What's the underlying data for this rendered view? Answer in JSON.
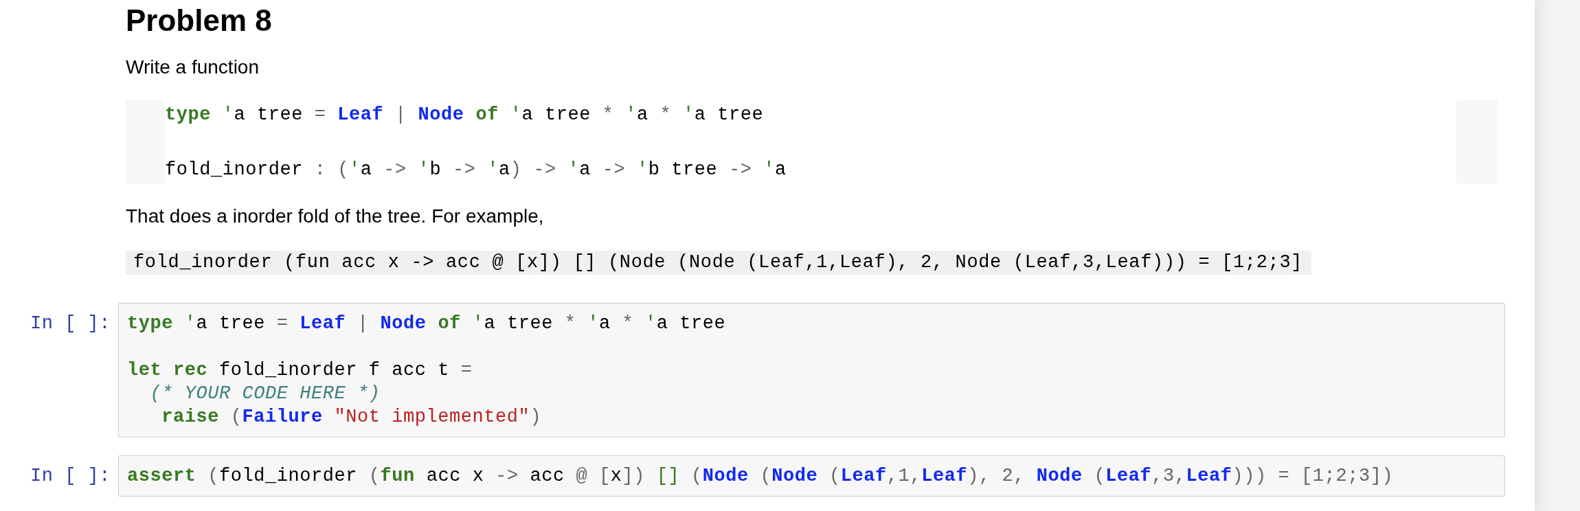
{
  "heading": "Problem 8",
  "intro": "Write a function",
  "signature_block": {
    "blocks": [
      [
        {
          "tokens": [
            {
              "kind": "keyword",
              "text": "type "
            },
            {
              "kind": "quote",
              "text": "'"
            },
            {
              "kind": "plain",
              "text": "a tree "
            },
            {
              "kind": "operator",
              "text": "= "
            },
            {
              "kind": "constructor",
              "text": "Leaf "
            },
            {
              "kind": "operator",
              "text": "| "
            },
            {
              "kind": "constructor",
              "text": "Node "
            },
            {
              "kind": "keyword",
              "text": "of "
            },
            {
              "kind": "quote",
              "text": "'"
            },
            {
              "kind": "plain",
              "text": "a tree "
            },
            {
              "kind": "operator",
              "text": "* "
            },
            {
              "kind": "quote",
              "text": "'"
            },
            {
              "kind": "plain",
              "text": "a "
            },
            {
              "kind": "operator",
              "text": "* "
            },
            {
              "kind": "quote",
              "text": "'"
            },
            {
              "kind": "plain",
              "text": "a tree"
            }
          ]
        }
      ],
      [
        {
          "tokens": [
            {
              "kind": "plain",
              "text": "fold_inorder "
            },
            {
              "kind": "operator",
              "text": ": ("
            },
            {
              "kind": "quote",
              "text": "'"
            },
            {
              "kind": "plain",
              "text": "a "
            },
            {
              "kind": "operator",
              "text": "-> "
            },
            {
              "kind": "quote",
              "text": "'"
            },
            {
              "kind": "plain",
              "text": "b "
            },
            {
              "kind": "operator",
              "text": "-> "
            },
            {
              "kind": "quote",
              "text": "'"
            },
            {
              "kind": "plain",
              "text": "a"
            },
            {
              "kind": "operator",
              "text": ") -> "
            },
            {
              "kind": "quote",
              "text": "'"
            },
            {
              "kind": "plain",
              "text": "a "
            },
            {
              "kind": "operator",
              "text": "-> "
            },
            {
              "kind": "quote",
              "text": "'"
            },
            {
              "kind": "plain",
              "text": "b tree "
            },
            {
              "kind": "operator",
              "text": "-> "
            },
            {
              "kind": "quote",
              "text": "'"
            },
            {
              "kind": "plain",
              "text": "a"
            }
          ]
        }
      ]
    ]
  },
  "description": "That does a inorder fold of the tree. For example,",
  "example": "fold_inorder (fun acc x -> acc @ [x]) [] (Node (Node (Leaf,1,Leaf), 2, Node (Leaf,3,Leaf))) = [1;2;3]",
  "cells": [
    {
      "prompt": "In [ ]:",
      "blocks": [
        [
          {
            "tokens": [
              {
                "kind": "keyword",
                "text": "type "
              },
              {
                "kind": "quote",
                "text": "'"
              },
              {
                "kind": "plain",
                "text": "a tree "
              },
              {
                "kind": "operator",
                "text": "= "
              },
              {
                "kind": "constructor",
                "text": "Leaf "
              },
              {
                "kind": "operator",
                "text": "| "
              },
              {
                "kind": "constructor",
                "text": "Node "
              },
              {
                "kind": "keyword",
                "text": "of "
              },
              {
                "kind": "quote",
                "text": "'"
              },
              {
                "kind": "plain",
                "text": "a tree "
              },
              {
                "kind": "operator",
                "text": "* "
              },
              {
                "kind": "quote",
                "text": "'"
              },
              {
                "kind": "plain",
                "text": "a "
              },
              {
                "kind": "operator",
                "text": "* "
              },
              {
                "kind": "quote",
                "text": "'"
              },
              {
                "kind": "plain",
                "text": "a tree"
              }
            ]
          }
        ],
        [
          {
            "tokens": [
              {
                "kind": "keyword",
                "text": "let "
              },
              {
                "kind": "keyword",
                "text": "rec "
              },
              {
                "kind": "plain",
                "text": "fold_inorder f acc t "
              },
              {
                "kind": "operator",
                "text": "="
              }
            ]
          },
          {
            "tokens": [
              {
                "kind": "comment",
                "text": "  (* YOUR CODE HERE *)"
              }
            ]
          },
          {
            "tokens": [
              {
                "kind": "keyword",
                "text": "   raise "
              },
              {
                "kind": "operator",
                "text": "("
              },
              {
                "kind": "constructor",
                "text": "Failure "
              },
              {
                "kind": "string",
                "text": "\"Not implemented\""
              },
              {
                "kind": "operator",
                "text": ")"
              }
            ]
          }
        ]
      ]
    },
    {
      "prompt": "In [ ]:",
      "blocks": [
        [
          {
            "tokens": [
              {
                "kind": "keyword",
                "text": "assert "
              },
              {
                "kind": "operator",
                "text": "("
              },
              {
                "kind": "plain",
                "text": "fold_inorder "
              },
              {
                "kind": "operator",
                "text": "("
              },
              {
                "kind": "keyword",
                "text": "fun "
              },
              {
                "kind": "plain",
                "text": "acc x "
              },
              {
                "kind": "operator",
                "text": "-> "
              },
              {
                "kind": "plain",
                "text": "acc "
              },
              {
                "kind": "operator",
                "text": "@ ["
              },
              {
                "kind": "plain",
                "text": "x"
              },
              {
                "kind": "operator",
                "text": "]) "
              },
              {
                "kind": "builtin",
                "text": "[] "
              },
              {
                "kind": "operator",
                "text": "("
              },
              {
                "kind": "constructor",
                "text": "Node "
              },
              {
                "kind": "operator",
                "text": "("
              },
              {
                "kind": "constructor",
                "text": "Node "
              },
              {
                "kind": "operator",
                "text": "("
              },
              {
                "kind": "constructor",
                "text": "Leaf"
              },
              {
                "kind": "operator",
                "text": ","
              },
              {
                "kind": "number",
                "text": "1"
              },
              {
                "kind": "operator",
                "text": ","
              },
              {
                "kind": "constructor",
                "text": "Leaf"
              },
              {
                "kind": "operator",
                "text": "), "
              },
              {
                "kind": "number",
                "text": "2"
              },
              {
                "kind": "operator",
                "text": ", "
              },
              {
                "kind": "constructor",
                "text": "Node "
              },
              {
                "kind": "operator",
                "text": "("
              },
              {
                "kind": "constructor",
                "text": "Leaf"
              },
              {
                "kind": "operator",
                "text": ","
              },
              {
                "kind": "number",
                "text": "3"
              },
              {
                "kind": "operator",
                "text": ","
              },
              {
                "kind": "constructor",
                "text": "Leaf"
              },
              {
                "kind": "operator",
                "text": "))) = ["
              },
              {
                "kind": "number",
                "text": "1"
              },
              {
                "kind": "operator",
                "text": ";"
              },
              {
                "kind": "number",
                "text": "2"
              },
              {
                "kind": "operator",
                "text": ";"
              },
              {
                "kind": "number",
                "text": "3"
              },
              {
                "kind": "operator",
                "text": "])"
              }
            ]
          }
        ]
      ]
    }
  ]
}
